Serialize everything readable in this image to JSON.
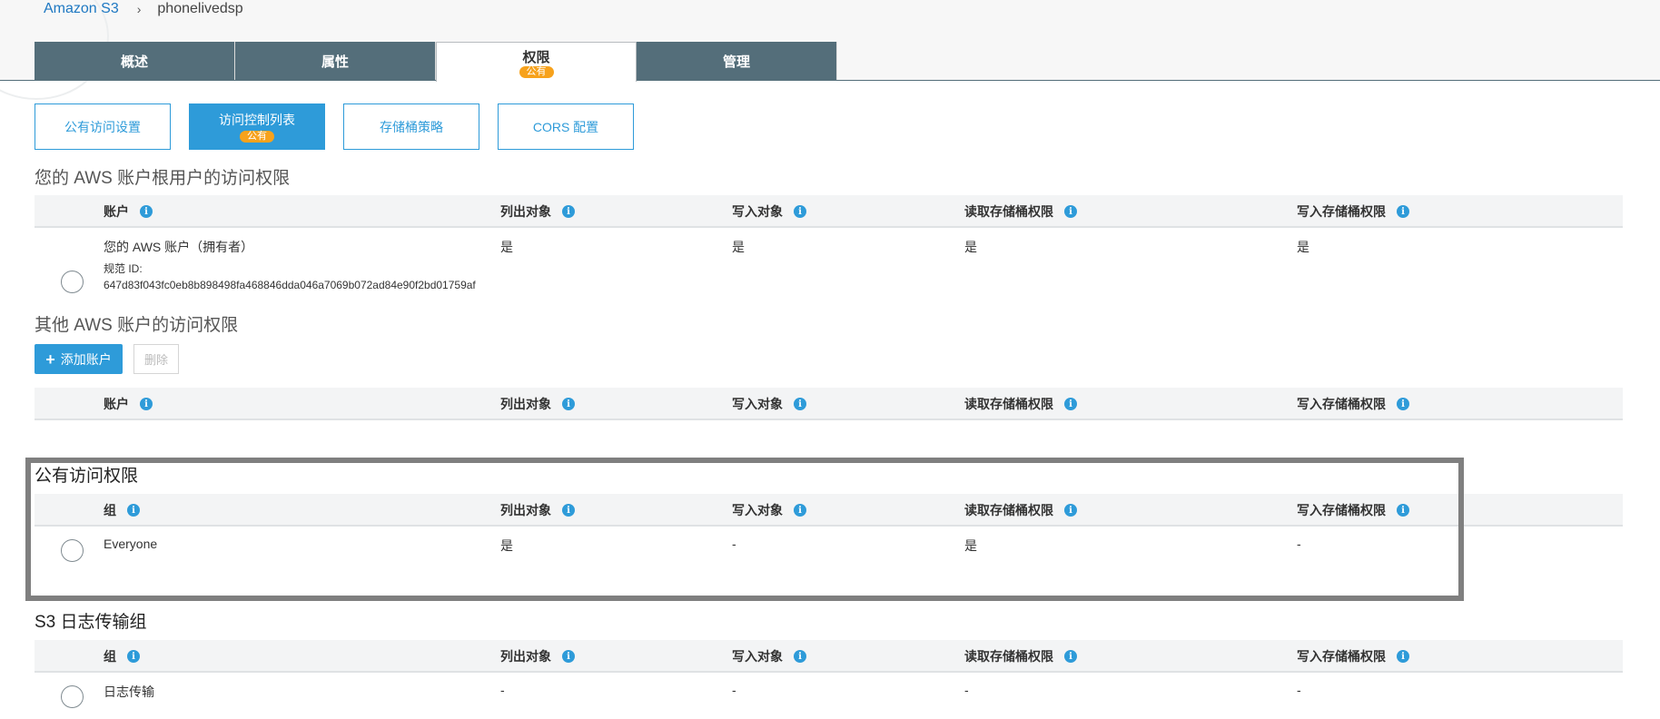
{
  "breadcrumb": {
    "root": "Amazon S3",
    "separator": "›",
    "current": "phonelivedsp"
  },
  "main_tabs": [
    {
      "label": "概述"
    },
    {
      "label": "属性"
    },
    {
      "label": "权限",
      "badge": "公有"
    },
    {
      "label": "管理"
    }
  ],
  "sub_tabs": [
    {
      "label": "公有访问设置"
    },
    {
      "label": "访问控制列表",
      "badge": "公有"
    },
    {
      "label": "存储桶策略"
    },
    {
      "label": "CORS 配置"
    }
  ],
  "columns": {
    "account": "账户",
    "group": "组",
    "list_objects": "列出对象",
    "write_objects": "写入对象",
    "read_bucket_perms": "读取存储桶权限",
    "write_bucket_perms": "写入存储桶权限"
  },
  "info_glyph": "i",
  "root_section": {
    "title": "您的 AWS 账户根用户的访问权限",
    "row": {
      "account": "您的 AWS 账户（拥有者）",
      "canonical_label": "规范 ID:",
      "canonical_id": "647d83f043fc0eb8b898498fa468846dda046a7069b072ad84e90f2bd01759af",
      "list_objects": "是",
      "write_objects": "是",
      "read_bucket_perms": "是",
      "write_bucket_perms": "是"
    }
  },
  "other_section": {
    "title": "其他 AWS 账户的访问权限",
    "add_button": "添加账户",
    "add_icon": "+",
    "delete_button": "删除"
  },
  "public_section": {
    "title": "公有访问权限",
    "row": {
      "group": "Everyone",
      "list_objects": "是",
      "write_objects": "-",
      "read_bucket_perms": "是",
      "write_bucket_perms": "-"
    }
  },
  "log_section": {
    "title": "S3 日志传输组",
    "row": {
      "group": "日志传输",
      "list_objects": "-",
      "write_objects": "-",
      "read_bucket_perms": "-",
      "write_bucket_perms": "-"
    }
  },
  "colors": {
    "tab_bg": "#546e7a",
    "accent": "#2e9bd9",
    "badge": "#f7a21c",
    "highlight_border": "#7f7f7f"
  }
}
